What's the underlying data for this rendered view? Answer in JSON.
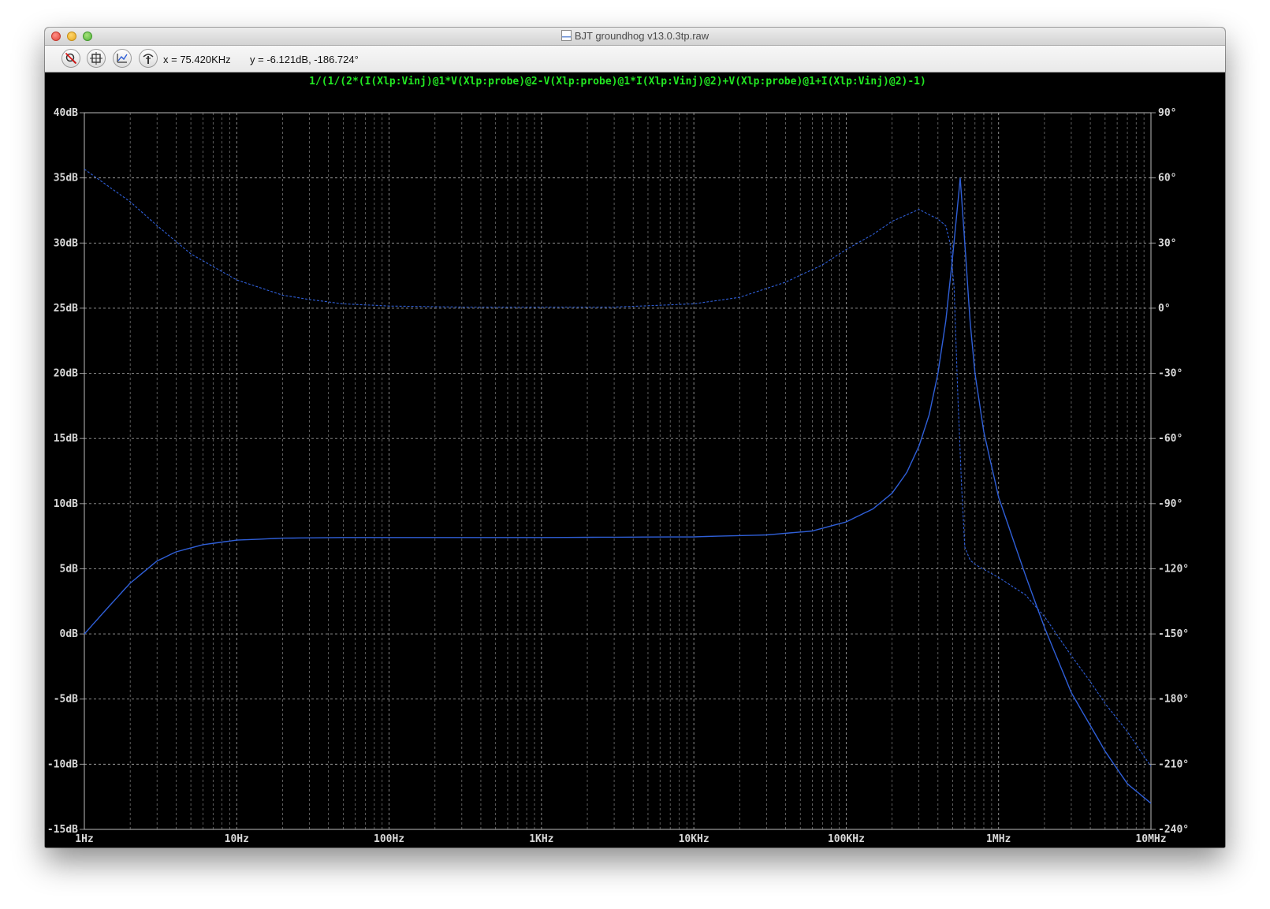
{
  "window": {
    "title": "BJT groundhog v13.0.3tp.raw"
  },
  "toolbar": {
    "icons": [
      "zoom-cancel-icon",
      "zoom-fit-icon",
      "autorange-icon",
      "probe-icon"
    ],
    "x_readout": "x = 75.420KHz",
    "y_readout": "y = -6.121dB, -186.724°"
  },
  "colors": {
    "background": "#000000",
    "grid": "#9a9a9a",
    "trace": "#2f5fd8",
    "title": "#22e622",
    "axis_text": "#d8d8d8"
  },
  "chart_data": {
    "type": "line",
    "title": "1/(1/(2*(I(Xlp:Vinj)@1*V(Xlp:probe)@2-V(Xlp:probe)@1*I(Xlp:Vinj)@2)+V(Xlp:probe)@1+I(Xlp:Vinj)@2)-1)",
    "x_scale": "log",
    "x_ticks": [
      {
        "value": 1,
        "label": "1Hz"
      },
      {
        "value": 10,
        "label": "10Hz"
      },
      {
        "value": 100,
        "label": "100Hz"
      },
      {
        "value": 1000,
        "label": "1KHz"
      },
      {
        "value": 10000,
        "label": "10KHz"
      },
      {
        "value": 100000,
        "label": "100KHz"
      },
      {
        "value": 1000000,
        "label": "1MHz"
      },
      {
        "value": 10000000,
        "label": "10MHz"
      }
    ],
    "xlim": [
      1,
      10000000
    ],
    "y_left_ticks": [
      {
        "value": 40,
        "label": "40dB"
      },
      {
        "value": 35,
        "label": "35dB"
      },
      {
        "value": 30,
        "label": "30dB"
      },
      {
        "value": 25,
        "label": "25dB"
      },
      {
        "value": 20,
        "label": "20dB"
      },
      {
        "value": 15,
        "label": "15dB"
      },
      {
        "value": 10,
        "label": "10dB"
      },
      {
        "value": 5,
        "label": "5dB"
      },
      {
        "value": 0,
        "label": "0dB"
      },
      {
        "value": -5,
        "label": "-5dB"
      },
      {
        "value": -10,
        "label": "-10dB"
      },
      {
        "value": -15,
        "label": "-15dB"
      }
    ],
    "ylim_left": [
      -15,
      40
    ],
    "y_right_ticks": [
      {
        "value": 90,
        "label": "90°"
      },
      {
        "value": 60,
        "label": "60°"
      },
      {
        "value": 30,
        "label": "30°"
      },
      {
        "value": 0,
        "label": "0°"
      },
      {
        "value": -30,
        "label": "-30°"
      },
      {
        "value": -60,
        "label": "-60°"
      },
      {
        "value": -90,
        "label": "-90°"
      },
      {
        "value": -120,
        "label": "-120°"
      },
      {
        "value": -150,
        "label": "-150°"
      },
      {
        "value": -180,
        "label": "-180°"
      },
      {
        "value": -210,
        "label": "-210°"
      },
      {
        "value": -240,
        "label": "-240°"
      }
    ],
    "ylim_right": [
      -240,
      90
    ],
    "grid": true,
    "series": [
      {
        "axis": "left",
        "style": "solid",
        "points": [
          [
            1,
            0.0
          ],
          [
            1.5,
            2.3
          ],
          [
            2,
            3.9
          ],
          [
            3,
            5.6
          ],
          [
            4,
            6.3
          ],
          [
            6,
            6.85
          ],
          [
            10,
            7.2
          ],
          [
            20,
            7.35
          ],
          [
            50,
            7.4
          ],
          [
            100,
            7.4
          ],
          [
            1000,
            7.4
          ],
          [
            10000,
            7.45
          ],
          [
            30000,
            7.6
          ],
          [
            60000,
            7.9
          ],
          [
            100000,
            8.6
          ],
          [
            150000,
            9.6
          ],
          [
            200000,
            10.8
          ],
          [
            250000,
            12.4
          ],
          [
            300000,
            14.4
          ],
          [
            350000,
            16.8
          ],
          [
            400000,
            20.0
          ],
          [
            450000,
            24.0
          ],
          [
            500000,
            29.0
          ],
          [
            560000,
            35.0
          ],
          [
            600000,
            30.0
          ],
          [
            650000,
            24.0
          ],
          [
            700000,
            20.0
          ],
          [
            800000,
            15.5
          ],
          [
            1000000,
            10.5
          ],
          [
            1500000,
            4.5
          ],
          [
            2000000,
            0.5
          ],
          [
            3000000,
            -4.5
          ],
          [
            5000000,
            -9.0
          ],
          [
            7000000,
            -11.5
          ],
          [
            10000000,
            -13.0
          ]
        ]
      },
      {
        "axis": "right",
        "style": "dashed",
        "points": [
          [
            1,
            64
          ],
          [
            2,
            49
          ],
          [
            3,
            38
          ],
          [
            5,
            25
          ],
          [
            10,
            13
          ],
          [
            20,
            6
          ],
          [
            30,
            4
          ],
          [
            50,
            2
          ],
          [
            100,
            1
          ],
          [
            300,
            0.5
          ],
          [
            1000,
            0.5
          ],
          [
            3000,
            0.5
          ],
          [
            10000,
            2
          ],
          [
            20000,
            5
          ],
          [
            40000,
            12
          ],
          [
            70000,
            20
          ],
          [
            100000,
            27
          ],
          [
            150000,
            34
          ],
          [
            200000,
            40
          ],
          [
            300000,
            45.5
          ],
          [
            400000,
            41
          ],
          [
            450000,
            38
          ],
          [
            480000,
            30
          ],
          [
            510000,
            10
          ],
          [
            540000,
            -40
          ],
          [
            570000,
            -80
          ],
          [
            600000,
            -110
          ],
          [
            650000,
            -116
          ],
          [
            700000,
            -118
          ],
          [
            1000000,
            -124
          ],
          [
            1500000,
            -132
          ],
          [
            2000000,
            -142
          ],
          [
            3000000,
            -160
          ],
          [
            4000000,
            -172
          ],
          [
            5000000,
            -182
          ],
          [
            7000000,
            -195
          ],
          [
            10000000,
            -211
          ]
        ]
      }
    ]
  }
}
